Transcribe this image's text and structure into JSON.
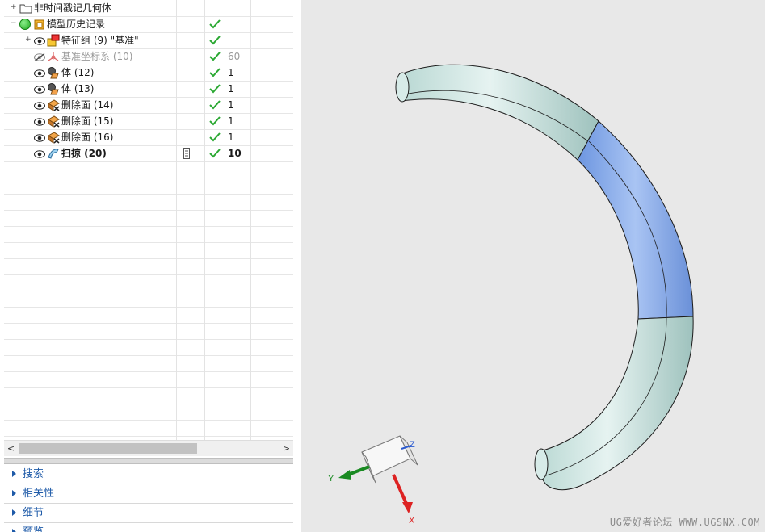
{
  "tree": {
    "rows": [
      {
        "label": "非时间戳记几何体",
        "indent": 0,
        "icon": "folder-icon",
        "check": false,
        "value": "",
        "style": "normal",
        "expander": "+"
      },
      {
        "label": "模型历史记录",
        "indent": 0,
        "icon": "model-history-icon",
        "check": true,
        "value": "",
        "style": "normal",
        "expander": "−"
      },
      {
        "label": "特征组 (9) \"基准\"",
        "indent": 1,
        "icon": "feature-group-icon",
        "check": true,
        "value": "",
        "style": "normal",
        "expander": "+",
        "eye": true
      },
      {
        "label": "基准坐标系 (10)",
        "indent": 1,
        "icon": "datum-csys-icon",
        "check": true,
        "value": "60",
        "style": "dim",
        "expander": "",
        "eye": "hidden"
      },
      {
        "label": "体 (12)",
        "indent": 1,
        "icon": "body-icon",
        "check": true,
        "value": "1",
        "style": "normal",
        "expander": "",
        "eye": true
      },
      {
        "label": "体 (13)",
        "indent": 1,
        "icon": "body-icon",
        "check": true,
        "value": "1",
        "style": "normal",
        "expander": "",
        "eye": true
      },
      {
        "label": "删除面 (14)",
        "indent": 1,
        "icon": "delete-face-icon",
        "check": true,
        "value": "1",
        "style": "normal",
        "expander": "",
        "eye": true
      },
      {
        "label": "删除面 (15)",
        "indent": 1,
        "icon": "delete-face-icon",
        "check": true,
        "value": "1",
        "style": "normal",
        "expander": "",
        "eye": true
      },
      {
        "label": "删除面 (16)",
        "indent": 1,
        "icon": "delete-face-icon",
        "check": true,
        "value": "1",
        "style": "normal",
        "expander": "",
        "eye": true
      },
      {
        "label": "扫掠 (20)",
        "indent": 1,
        "icon": "swept-icon",
        "check": true,
        "value": "10",
        "style": "bold",
        "expander": "",
        "eye": true,
        "extra_icon": "update-status-icon"
      }
    ]
  },
  "sections": [
    "搜索",
    "相关性",
    "细节",
    "预览"
  ],
  "scroll_arrows": {
    "left": "<",
    "right": ">"
  },
  "triad": {
    "x": "X",
    "y": "Y",
    "z": "Z"
  },
  "watermark": "UG爱好者论坛 WWW.UGSNX.COM",
  "colors": {
    "check": "#2aa832",
    "part_body": "#c7e3df",
    "selected_face": "#7fa6ea",
    "edge": "#1c1c1c",
    "section_title": "#1e5aa8"
  }
}
